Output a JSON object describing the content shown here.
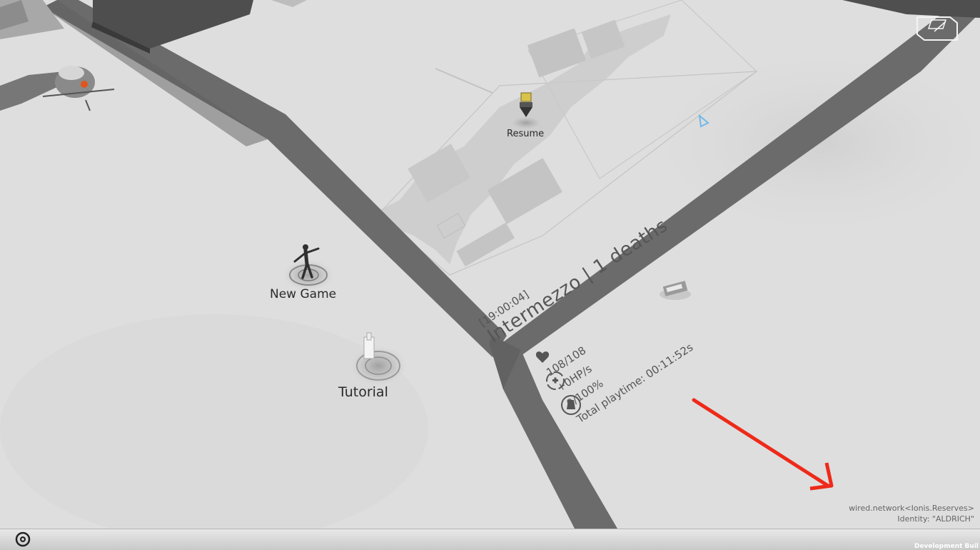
{
  "menu": {
    "resume_label": "Resume",
    "new_game_label": "New Game",
    "tutorial_label": "Tutorial"
  },
  "save": {
    "time": "[19:00:04]",
    "title": "Intermezzo | 1 deaths",
    "health": "108/108",
    "regen": "+0HP/s",
    "progress": "0/100%",
    "playtime": "Total playtime: 00:11:52s"
  },
  "network": {
    "line1": "wired.network<Ionis.Reserves>",
    "line2": "Identity: \"ALDRICH\""
  },
  "footer": {
    "dev_build": "Development Buil"
  },
  "icons": [
    "heart-icon",
    "medkit-regen-icon",
    "progress-flask-icon",
    "game-logo-icon",
    "window-restore-icon"
  ],
  "colors": {
    "ground": "#dcdcdc",
    "road": "#6b6b6b",
    "resume_marker": "#d9c24a",
    "annotation_arrow": "#ee2a1a"
  }
}
